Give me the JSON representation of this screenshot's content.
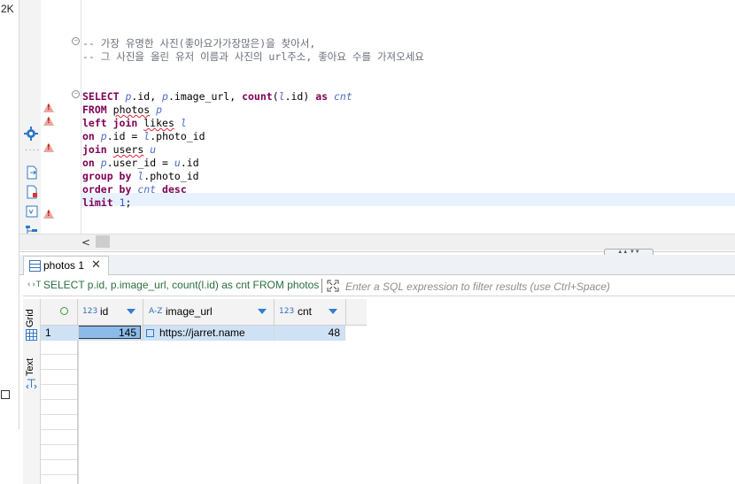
{
  "side": {
    "label": "2K"
  },
  "editor": {
    "lines": [
      {
        "tokens": [
          {
            "t": "-- 가장 유명한 사진(좋아요가가장많은)을 찾아서,",
            "c": "cmt"
          }
        ]
      },
      {
        "tokens": [
          {
            "t": "-- 그 사진을 올린 유저 이름과 사진의 url주소, 좋아요 수를 가져오세요",
            "c": "cmt"
          }
        ]
      },
      {
        "tokens": [
          {
            "t": "SELECT",
            "c": "kw"
          },
          {
            "t": " ",
            "c": "txt"
          },
          {
            "t": "p",
            "c": "al"
          },
          {
            "t": ".id, ",
            "c": "txt"
          },
          {
            "t": "p",
            "c": "al"
          },
          {
            "t": ".image_url, ",
            "c": "txt"
          },
          {
            "t": "count",
            "c": "fn"
          },
          {
            "t": "(",
            "c": "txt"
          },
          {
            "t": "l",
            "c": "al"
          },
          {
            "t": ".id) ",
            "c": "txt"
          },
          {
            "t": "as",
            "c": "kw"
          },
          {
            "t": " ",
            "c": "txt"
          },
          {
            "t": "cnt",
            "c": "al"
          }
        ]
      },
      {
        "tokens": [
          {
            "t": "FROM",
            "c": "kw"
          },
          {
            "t": " ",
            "c": "txt"
          },
          {
            "t": "photos",
            "c": "txt uline"
          },
          {
            "t": " ",
            "c": "txt"
          },
          {
            "t": "p",
            "c": "al"
          }
        ]
      },
      {
        "tokens": [
          {
            "t": "left join",
            "c": "kw"
          },
          {
            "t": " ",
            "c": "txt"
          },
          {
            "t": "likes",
            "c": "txt uline"
          },
          {
            "t": " ",
            "c": "txt"
          },
          {
            "t": "l",
            "c": "al"
          }
        ]
      },
      {
        "tokens": [
          {
            "t": "on",
            "c": "kw"
          },
          {
            "t": " ",
            "c": "txt"
          },
          {
            "t": "p",
            "c": "al"
          },
          {
            "t": ".id = ",
            "c": "txt"
          },
          {
            "t": "l",
            "c": "al"
          },
          {
            "t": ".photo_id",
            "c": "txt"
          }
        ]
      },
      {
        "tokens": [
          {
            "t": "join",
            "c": "kw"
          },
          {
            "t": " ",
            "c": "txt"
          },
          {
            "t": "users",
            "c": "txt uline"
          },
          {
            "t": " ",
            "c": "txt"
          },
          {
            "t": "u",
            "c": "al"
          }
        ]
      },
      {
        "tokens": [
          {
            "t": "on",
            "c": "kw"
          },
          {
            "t": " ",
            "c": "txt"
          },
          {
            "t": "p",
            "c": "al"
          },
          {
            "t": ".user_id = ",
            "c": "txt"
          },
          {
            "t": "u",
            "c": "al"
          },
          {
            "t": ".id",
            "c": "txt"
          }
        ]
      },
      {
        "tokens": [
          {
            "t": "group by",
            "c": "kw"
          },
          {
            "t": " ",
            "c": "txt"
          },
          {
            "t": "l",
            "c": "al"
          },
          {
            "t": ".photo_id",
            "c": "txt"
          }
        ]
      },
      {
        "tokens": [
          {
            "t": "order by",
            "c": "kw"
          },
          {
            "t": " ",
            "c": "txt"
          },
          {
            "t": "cnt",
            "c": "al"
          },
          {
            "t": " ",
            "c": "txt"
          },
          {
            "t": "desc",
            "c": "kw"
          }
        ]
      },
      {
        "tokens": [
          {
            "t": "limit",
            "c": "kw"
          },
          {
            "t": " ",
            "c": "txt"
          },
          {
            "t": "1",
            "c": "num"
          },
          {
            "t": ";",
            "c": "txt"
          }
        ]
      }
    ]
  },
  "results": {
    "tab_label": "photos 1",
    "filter": {
      "query_text": "SELECT p.id, p.image_url, count(l.id) as cnt FROM photos",
      "placeholder": "Enter a SQL expression to filter results (use Ctrl+Space)"
    },
    "view_tabs": {
      "grid": "Grid",
      "text": "Text"
    },
    "columns": [
      {
        "type": "123",
        "name": "id"
      },
      {
        "type": "A-Z",
        "name": "image_url"
      },
      {
        "type": "123",
        "name": "cnt"
      }
    ],
    "rows": [
      {
        "num": "1",
        "id": "145",
        "image_url": "https://jarret.name",
        "cnt": "48"
      }
    ]
  },
  "colors": {
    "keyword": "#7f0055",
    "alias": "#4a6cc7",
    "comment": "#6a6f7a",
    "selection": "#cfe2f5"
  }
}
